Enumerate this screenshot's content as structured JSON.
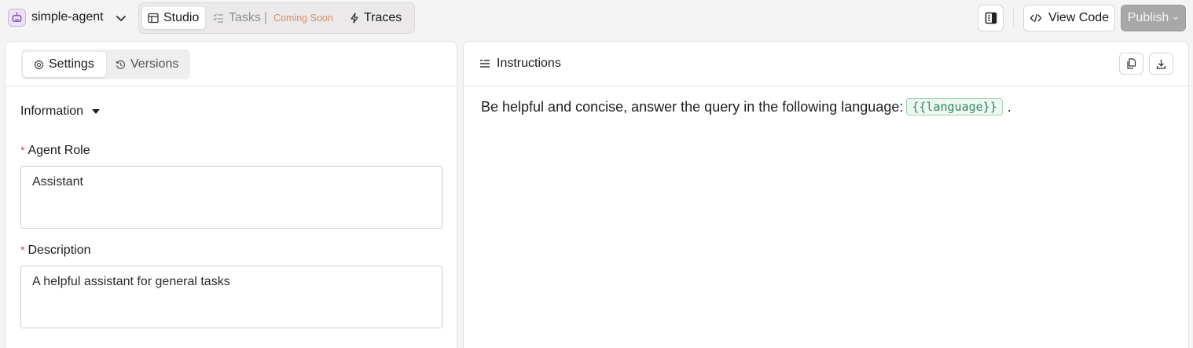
{
  "header": {
    "agent_name": "simple-agent",
    "tabs": {
      "studio": "Studio",
      "tasks": "Tasks",
      "tasks_separator": "|",
      "tasks_badge": "Coming Soon",
      "traces": "Traces"
    },
    "view_code_label": "View Code",
    "publish_label": "Publish"
  },
  "left_panel": {
    "tabs": {
      "settings": "Settings",
      "versions": "Versions"
    },
    "section_title": "Information",
    "fields": [
      {
        "label": "Agent Role",
        "required_mark": "*",
        "value": "Assistant"
      },
      {
        "label": "Description",
        "required_mark": "*",
        "value": "A helpful assistant for general tasks"
      }
    ]
  },
  "right_panel": {
    "title": "Instructions",
    "text_before": "Be helpful and concise, answer the query in the following language:",
    "variable": "{{language}}",
    "text_after": "."
  },
  "colors": {
    "accent_purple": "#8a52c9",
    "required_red": "#e0453a",
    "variable_green": "#2f8a5b",
    "coming_soon_orange": "#d4906b",
    "publish_disabled": "#a8a8a8"
  },
  "icons": {
    "agent_logo": "robot-icon",
    "studio": "table-icon",
    "tasks": "checklist-icon",
    "traces": "lightning-icon",
    "sidebar_toggle": "sidebar-panel-icon",
    "view_code": "code-icon",
    "publish_menu": "chevron-down-icon",
    "settings": "gear-icon",
    "versions": "history-icon",
    "information_toggle": "caret-down-icon",
    "instructions": "text-lines-icon",
    "copy": "copy-icon",
    "download": "download-icon"
  }
}
